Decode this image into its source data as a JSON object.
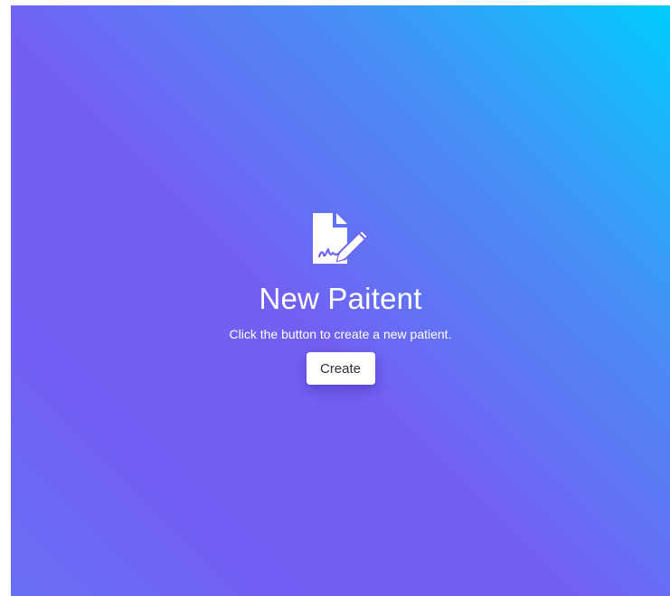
{
  "hero": {
    "icon": "file-signature-icon",
    "title": "New Paitent",
    "subtitle": "Click the button to create a new patient.",
    "create_label": "Create"
  },
  "colors": {
    "gradient_top_right": "#00cdfd",
    "gradient_mid": "#7360f3",
    "text": "#ffffff",
    "button_bg": "#ffffff",
    "button_text": "#2f2f3a"
  }
}
